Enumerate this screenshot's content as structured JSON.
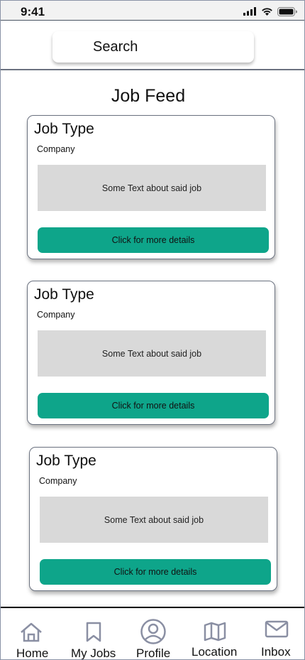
{
  "status_bar": {
    "time": "9:41"
  },
  "search": {
    "label": "Search"
  },
  "feed": {
    "title": "Job Feed",
    "cards": [
      {
        "job_type": "Job Type",
        "company": "Company",
        "description": "Some Text about said job",
        "button": "Click for more details"
      },
      {
        "job_type": "Job Type",
        "company": "Company",
        "description": "Some Text about said job",
        "button": "Click for more details"
      },
      {
        "job_type": "Job Type",
        "company": "Company",
        "description": "Some Text about said job",
        "button": "Click for more details"
      }
    ]
  },
  "nav": {
    "items": [
      {
        "label": "Home",
        "icon": "home-icon"
      },
      {
        "label": "My Jobs",
        "icon": "bookmark-icon"
      },
      {
        "label": "Profile",
        "icon": "profile-icon"
      },
      {
        "label": "Location",
        "icon": "map-icon"
      },
      {
        "label": "Inbox",
        "icon": "mail-icon"
      }
    ]
  },
  "colors": {
    "accent": "#0ea58a",
    "placeholder": "#d9d9d9",
    "icon": "#8a8fa3"
  }
}
